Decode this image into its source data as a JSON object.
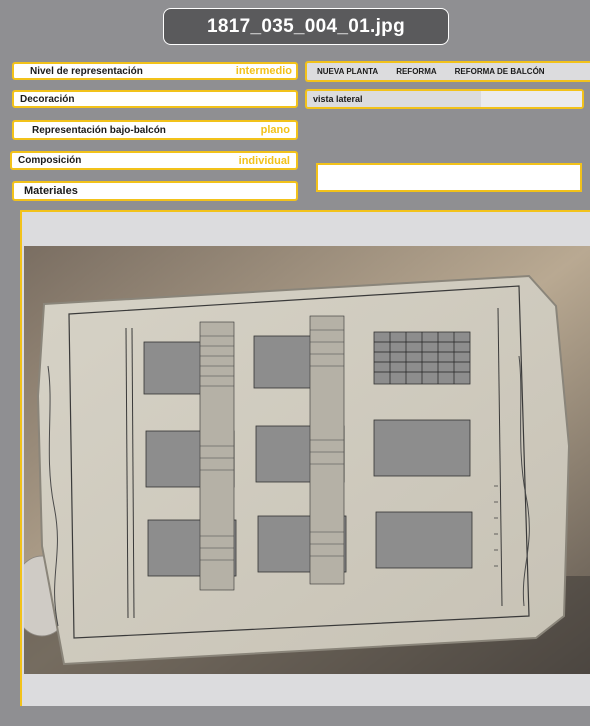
{
  "window": {
    "title": "1817_035_004_01.jpg"
  },
  "fields": {
    "nivel": {
      "label": "Nivel de representación",
      "value": "intermedio"
    },
    "decoracion": {
      "label": "Decoración"
    },
    "bajo_balcon": {
      "label": "Representación bajo-balcón",
      "value": "plano"
    },
    "composicion": {
      "label": "Composición",
      "value": "individual"
    },
    "materiales": {
      "label": "Materiales"
    }
  },
  "tabs": [
    "NUEVA PLANTA",
    "REFORMA",
    "REFORMA DE  BALCÓN"
  ],
  "view": {
    "label": "vista lateral"
  },
  "photo": {
    "alt": "Fotografía de un plano antiguo: alzado de fachada con tres columnas de vanos"
  },
  "colors": {
    "accent": "#f2c21a",
    "background": "#8f8f92",
    "title_bg": "#5a5a5c",
    "panel": "#dcdcde"
  }
}
